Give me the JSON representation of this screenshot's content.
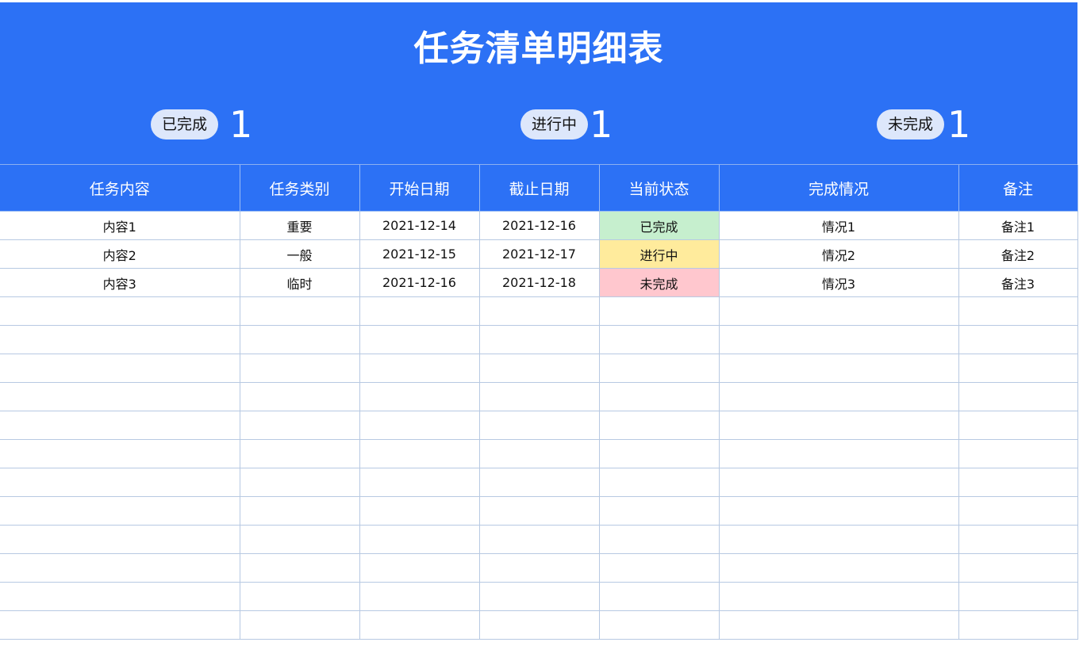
{
  "title": "任务清单明细表",
  "summary": [
    {
      "label": "已完成",
      "count": "1"
    },
    {
      "label": "进行中",
      "count": "1"
    },
    {
      "label": "未完成",
      "count": "1"
    }
  ],
  "table": {
    "headers": [
      "任务内容",
      "任务类别",
      "开始日期",
      "截止日期",
      "当前状态",
      "完成情况",
      "备注"
    ],
    "rows": [
      [
        "内容1",
        "重要",
        "2021-12-14",
        "2021-12-16",
        "已完成",
        "情况1",
        "备注1"
      ],
      [
        "内容2",
        "一般",
        "2021-12-15",
        "2021-12-17",
        "进行中",
        "情况2",
        "备注2"
      ],
      [
        "内容3",
        "临时",
        "2021-12-16",
        "2021-12-18",
        "未完成",
        "情况3",
        "备注3"
      ]
    ]
  },
  "colors": {
    "banner": "#2c71f5",
    "done_fill": "#c6efce",
    "progress_fill": "#ffeb9c",
    "todo_fill": "#ffc7ce"
  }
}
